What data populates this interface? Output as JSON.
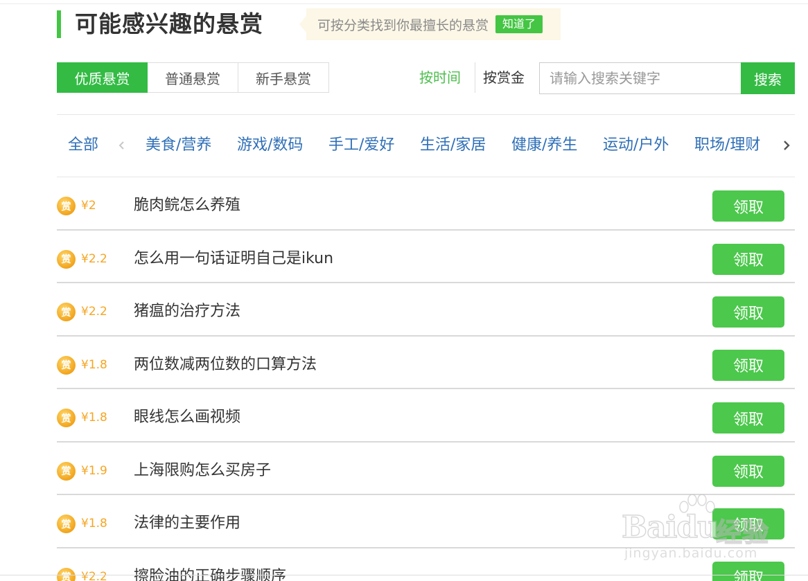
{
  "header": {
    "title": "可能感兴趣的悬赏",
    "tip_text": "可按分类找到你最擅长的悬赏",
    "tip_ok": "知道了"
  },
  "tabs": [
    {
      "label": "优质悬赏",
      "active": true
    },
    {
      "label": "普通悬赏",
      "active": false
    },
    {
      "label": "新手悬赏",
      "active": false
    }
  ],
  "sort": {
    "by_time": "按时间",
    "by_amount": "按赏金"
  },
  "search": {
    "placeholder": "请输入搜索关键字",
    "button": "搜索"
  },
  "categories": {
    "all": "全部",
    "items": [
      "美食/营养",
      "游戏/数码",
      "手工/爱好",
      "生活/家居",
      "健康/养生",
      "运动/户外",
      "职场/理财"
    ],
    "prev_icon": "chevron-left-icon",
    "next_icon": "chevron-right-icon"
  },
  "list": {
    "coin_glyph": "赏",
    "claim_label": "领取",
    "items": [
      {
        "price": "¥2",
        "title": "脆肉鲩怎么养殖"
      },
      {
        "price": "¥2.2",
        "title": "怎么用一句话证明自己是ikun"
      },
      {
        "price": "¥2.2",
        "title": "猪瘟的治疗方法"
      },
      {
        "price": "¥1.8",
        "title": "两位数减两位数的口算方法"
      },
      {
        "price": "¥1.8",
        "title": "眼线怎么画视频"
      },
      {
        "price": "¥1.9",
        "title": "上海限购怎么买房子"
      },
      {
        "price": "¥1.8",
        "title": "法律的主要作用"
      },
      {
        "price": "¥2.2",
        "title": "擦脸油的正确步骤顺序"
      }
    ]
  },
  "watermark": {
    "brand": "Baidu",
    "brand_cn": "经验",
    "url": "jingyan.baidu.com"
  },
  "colors": {
    "accent": "#33bb44",
    "claim": "#4cc84c",
    "price": "#f5a623",
    "category": "#2f6fb7"
  }
}
